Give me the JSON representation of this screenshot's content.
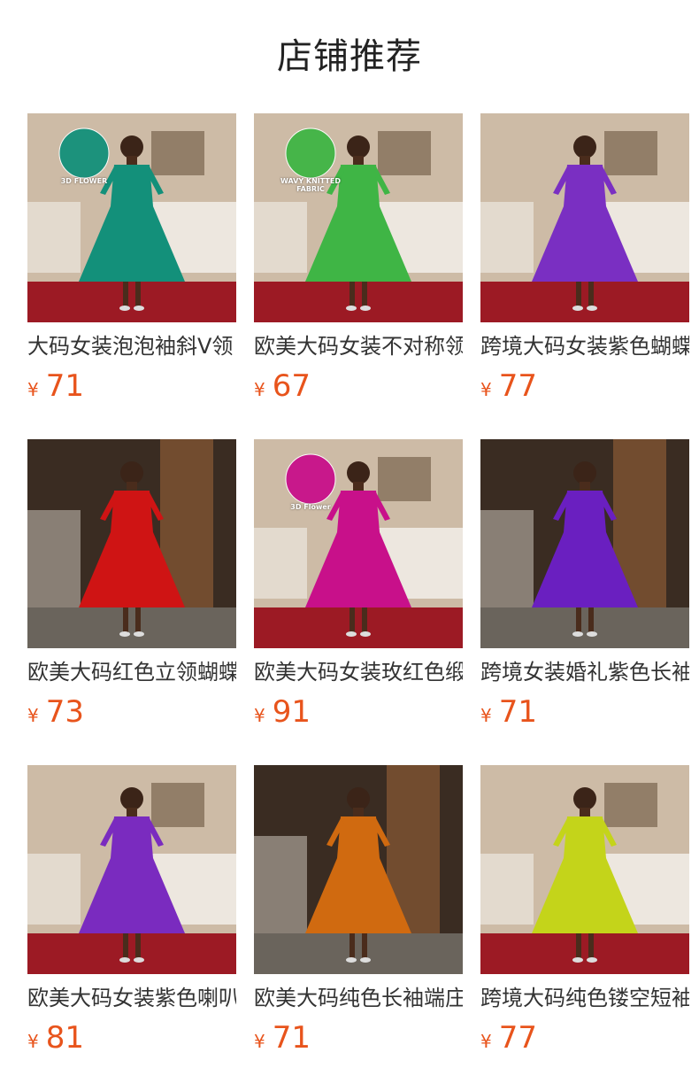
{
  "header": {
    "title": "店铺推荐"
  },
  "currency": "¥",
  "products": [
    {
      "title": "大码女装泡泡袖斜V领",
      "price": "71",
      "dress_color": "#13907a",
      "scene": "light",
      "badge": "3D FLOWER"
    },
    {
      "title": "欧美大码女装不对称领",
      "price": "67",
      "dress_color": "#3fb545",
      "scene": "light",
      "badge": "WAVY KNITTED FABRIC"
    },
    {
      "title": "跨境大码女装紫色蝴蝶",
      "price": "77",
      "dress_color": "#7a2fc2",
      "scene": "light",
      "badge": ""
    },
    {
      "title": "欧美大码红色立领蝴蝶",
      "price": "73",
      "dress_color": "#cf1414",
      "scene": "dark",
      "badge": ""
    },
    {
      "title": "欧美大码女装玫红色缎",
      "price": "91",
      "dress_color": "#c8108a",
      "scene": "light",
      "badge": "3D Flower"
    },
    {
      "title": "跨境女装婚礼紫色长袖",
      "price": "71",
      "dress_color": "#6a1fc0",
      "scene": "dark",
      "badge": ""
    },
    {
      "title": "欧美大码女装紫色喇叭",
      "price": "81",
      "dress_color": "#7a2bbf",
      "scene": "light",
      "badge": ""
    },
    {
      "title": "欧美大码纯色长袖端庄",
      "price": "71",
      "dress_color": "#d06a10",
      "scene": "dark",
      "badge": ""
    },
    {
      "title": "跨境大码纯色镂空短袖",
      "price": "77",
      "dress_color": "#c4d41a",
      "scene": "light",
      "badge": ""
    }
  ]
}
